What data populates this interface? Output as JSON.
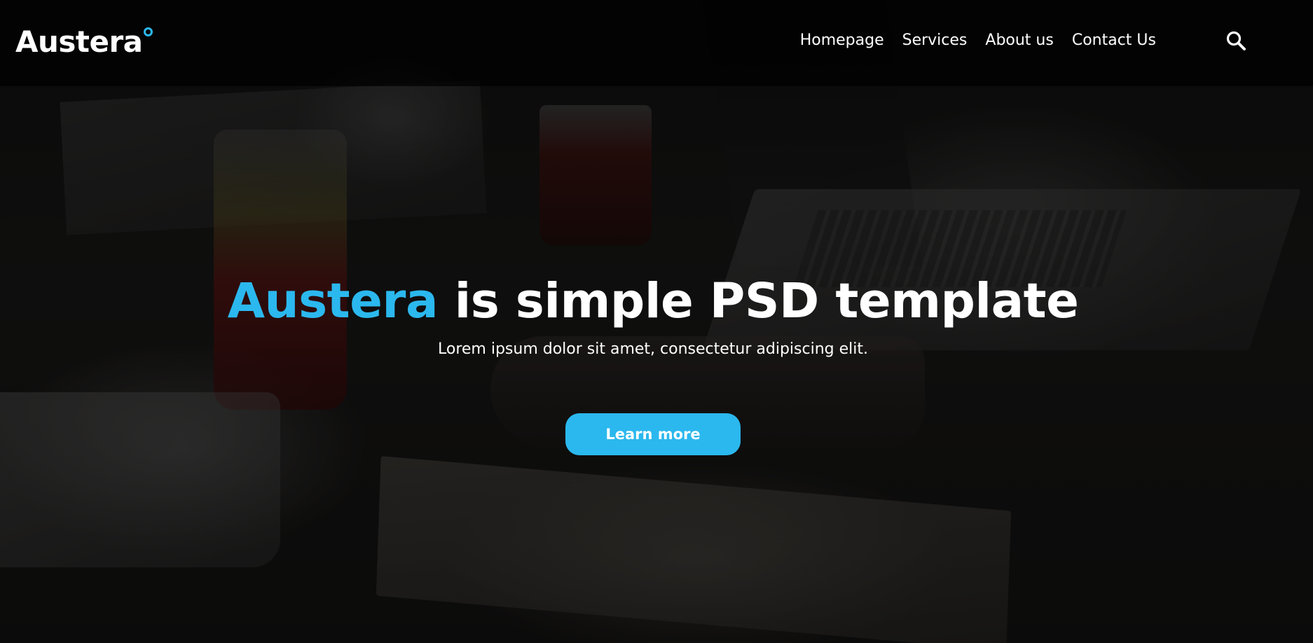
{
  "brand": {
    "name": "Austera",
    "accent_color": "#2bb8ee"
  },
  "nav": {
    "items": [
      {
        "label": "Homepage"
      },
      {
        "label": "Services"
      },
      {
        "label": "About us"
      },
      {
        "label": "Contact Us"
      }
    ],
    "search_icon": "search-icon"
  },
  "hero": {
    "headline_accent": "Austera",
    "headline_rest": "is simple PSD template",
    "subtitle": "Lorem ipsum dolor sit amet, consectetur adipiscing elit.",
    "cta_label": "Learn more"
  }
}
